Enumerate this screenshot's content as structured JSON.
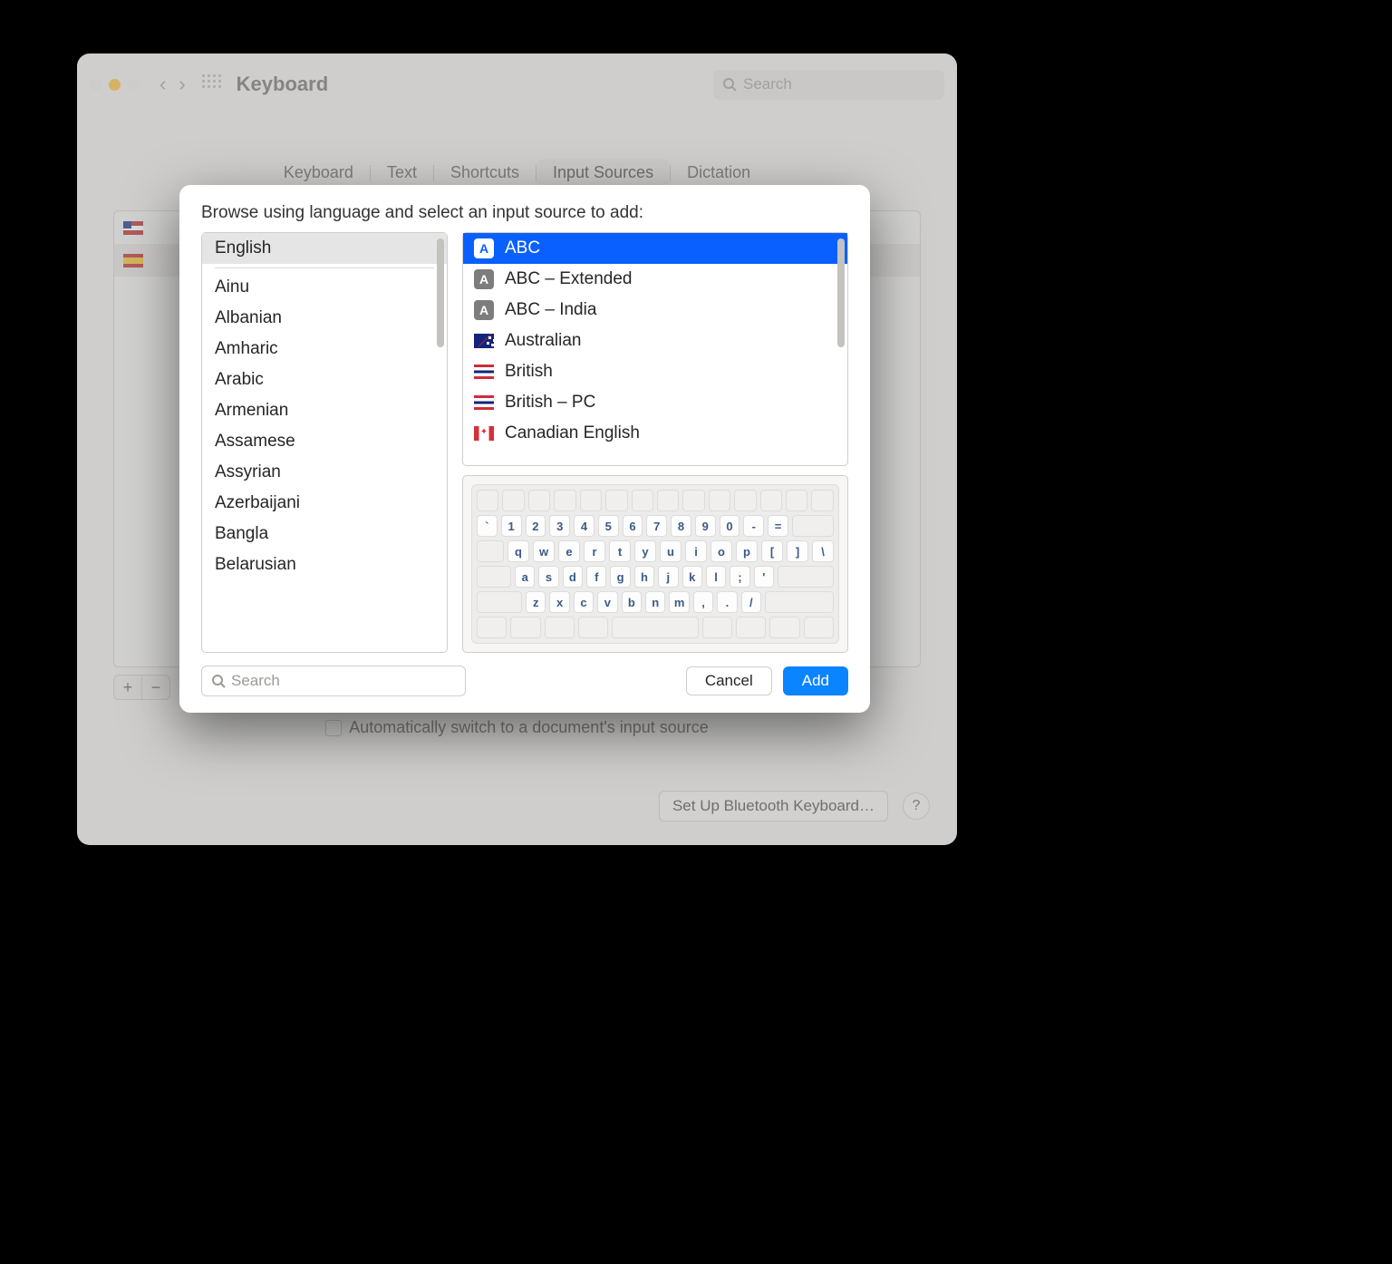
{
  "window": {
    "title": "Keyboard",
    "search_placeholder": "Search"
  },
  "tabs": {
    "items": [
      "Keyboard",
      "Text",
      "Shortcuts",
      "Input Sources",
      "Dictation"
    ],
    "active_index": 3
  },
  "existing_sources": [
    {
      "flag": "us"
    },
    {
      "flag": "es"
    }
  ],
  "auto_switch_label": "Automatically switch to a document's input source",
  "bluetooth_button": "Set Up Bluetooth Keyboard…",
  "sheet": {
    "prompt": "Browse using language and select an input source to add:",
    "search_placeholder": "Search",
    "cancel_label": "Cancel",
    "add_label": "Add",
    "languages": [
      "English",
      "Ainu",
      "Albanian",
      "Amharic",
      "Arabic",
      "Armenian",
      "Assamese",
      "Assyrian",
      "Azerbaijani",
      "Bangla",
      "Belarusian"
    ],
    "selected_language_index": 0,
    "sources": [
      {
        "label": "ABC",
        "icon": "A-white"
      },
      {
        "label": "ABC – Extended",
        "icon": "A-gray"
      },
      {
        "label": "ABC – India",
        "icon": "A-gray"
      },
      {
        "label": "Australian",
        "icon": "flag-au"
      },
      {
        "label": "British",
        "icon": "flag-gb"
      },
      {
        "label": "British – PC",
        "icon": "flag-gb"
      },
      {
        "label": "Canadian English",
        "icon": "flag-ca"
      }
    ],
    "selected_source_index": 0,
    "keyboard_rows": [
      [
        "`",
        "1",
        "2",
        "3",
        "4",
        "5",
        "6",
        "7",
        "8",
        "9",
        "0",
        "-",
        "="
      ],
      [
        "q",
        "w",
        "e",
        "r",
        "t",
        "y",
        "u",
        "i",
        "o",
        "p",
        "[",
        "]",
        "\\"
      ],
      [
        "a",
        "s",
        "d",
        "f",
        "g",
        "h",
        "j",
        "k",
        "l",
        ";",
        "'"
      ],
      [
        "z",
        "x",
        "c",
        "v",
        "b",
        "n",
        "m",
        ",",
        ".",
        "/"
      ]
    ]
  }
}
